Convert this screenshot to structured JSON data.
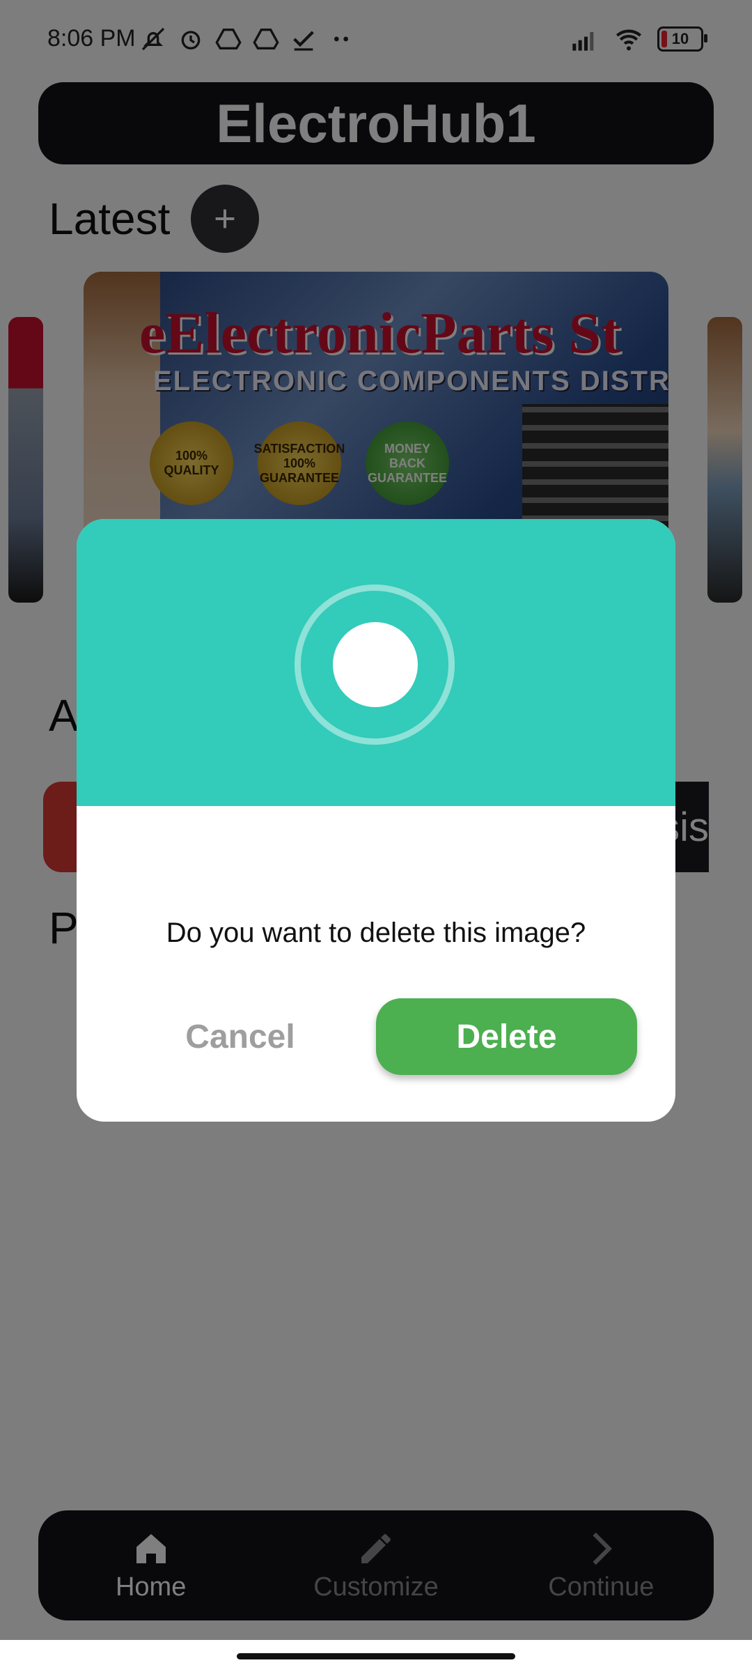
{
  "status_bar": {
    "time": "8:06 PM",
    "battery": "10"
  },
  "app_bar": {
    "title": "ElectroHub1"
  },
  "latest": {
    "label": "Latest",
    "add_icon": "plus-icon"
  },
  "carousel": {
    "headline": "eElectronicParts St",
    "subline": "ELECTRONIC COMPONENTS DISTR",
    "badges": [
      "100% QUALITY",
      "SATISFACTION 100% GUARANTEE",
      "MONEY BACK GUARANTEE"
    ]
  },
  "sections": {
    "a_label": "A",
    "p_label": "P",
    "chip_text": "sis"
  },
  "dialog": {
    "message": "Do you want to delete this image?",
    "cancel_label": "Cancel",
    "delete_label": "Delete",
    "accent_color": "#33cbb9",
    "delete_color": "#4caf50"
  },
  "bottom_nav": {
    "items": [
      {
        "label": "Home",
        "icon": "home-icon",
        "active": true
      },
      {
        "label": "Customize",
        "icon": "pencil-icon",
        "active": false
      },
      {
        "label": "Continue",
        "icon": "chevron-right-icon",
        "active": false
      }
    ]
  }
}
